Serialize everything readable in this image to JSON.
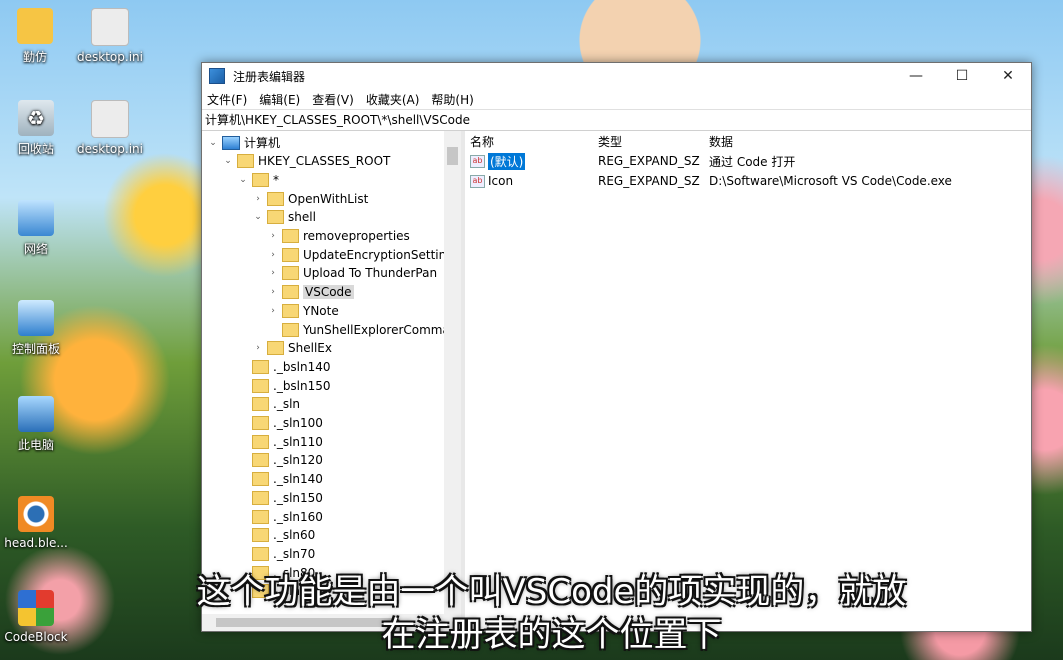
{
  "desktop": {
    "icons": [
      {
        "label": "勤仿"
      },
      {
        "label": "desktop.ini"
      },
      {
        "label": "回收站"
      },
      {
        "label": "desktop.ini"
      },
      {
        "label": "网络"
      },
      {
        "label": "控制面板"
      },
      {
        "label": "此电脑"
      },
      {
        "label": "head.ble..."
      },
      {
        "label": "CodeBlock"
      }
    ]
  },
  "window": {
    "title": "注册表编辑器",
    "controls": {
      "minimize": "—",
      "maximize": "☐",
      "close": "✕"
    },
    "menu": [
      "文件(F)",
      "编辑(E)",
      "查看(V)",
      "收藏夹(A)",
      "帮助(H)"
    ],
    "address": "计算机\\HKEY_CLASSES_ROOT\\*\\shell\\VSCode",
    "tree": [
      {
        "label": "计算机",
        "expander": "⌄"
      },
      {
        "label": "HKEY_CLASSES_ROOT",
        "expander": "⌄"
      },
      {
        "label": "*",
        "expander": "⌄"
      },
      {
        "label": "OpenWithList",
        "expander": "›"
      },
      {
        "label": "shell",
        "expander": "⌄"
      },
      {
        "label": "removeproperties",
        "expander": "›"
      },
      {
        "label": "UpdateEncryptionSettings\\",
        "expander": "›"
      },
      {
        "label": "Upload To ThunderPan",
        "expander": "›"
      },
      {
        "label": "VSCode",
        "expander": "›"
      },
      {
        "label": "YNote",
        "expander": "›"
      },
      {
        "label": "YunShellExplorerCommanc",
        "expander": ""
      },
      {
        "label": "ShellEx",
        "expander": "›"
      },
      {
        "label": "._bsln140",
        "expander": ""
      },
      {
        "label": "._bsln150",
        "expander": ""
      },
      {
        "label": "._sln",
        "expander": ""
      },
      {
        "label": "._sln100",
        "expander": ""
      },
      {
        "label": "._sln110",
        "expander": ""
      },
      {
        "label": "._sln120",
        "expander": ""
      },
      {
        "label": "._sln140",
        "expander": ""
      },
      {
        "label": "._sln150",
        "expander": ""
      },
      {
        "label": "._sln160",
        "expander": ""
      },
      {
        "label": "._sln60",
        "expander": ""
      },
      {
        "label": "._sln70",
        "expander": ""
      },
      {
        "label": "._sln80",
        "expander": ""
      },
      {
        "label": "._sln90",
        "expander": ""
      }
    ],
    "list": {
      "headers": {
        "name": "名称",
        "type": "类型",
        "data": "数据"
      },
      "rows": [
        {
          "name": "(默认)",
          "type": "REG_EXPAND_SZ",
          "data": "通过 Code 打开"
        },
        {
          "name": "Icon",
          "type": "REG_EXPAND_SZ",
          "data": "D:\\Software\\Microsoft VS Code\\Code.exe"
        }
      ]
    }
  },
  "subtitles": {
    "line1": "这个功能是由一个叫VSCode的项实现的，就放",
    "line2": "在注册表的这个位置下"
  }
}
